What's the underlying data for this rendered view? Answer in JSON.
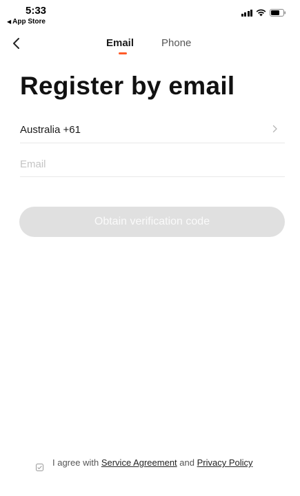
{
  "status_bar": {
    "time": "5:33",
    "back_label": "App Store"
  },
  "nav": {
    "tabs": [
      {
        "label": "Email",
        "active": true
      },
      {
        "label": "Phone",
        "active": false
      }
    ],
    "indicator_color": "#ff5a28"
  },
  "title": "Register by email",
  "country": {
    "label": "Australia +61"
  },
  "email": {
    "value": "",
    "placeholder": "Email"
  },
  "verify_button": {
    "label": "Obtain verification code",
    "enabled": false
  },
  "agreement": {
    "prefix": "I agree with",
    "service_link": "Service Agreement",
    "connector": "and",
    "privacy_link": "Privacy Policy"
  },
  "icons": {
    "back": "chevron-left-icon",
    "country_chevron": "chevron-right-icon",
    "checkbox": "checkbox-icon"
  }
}
